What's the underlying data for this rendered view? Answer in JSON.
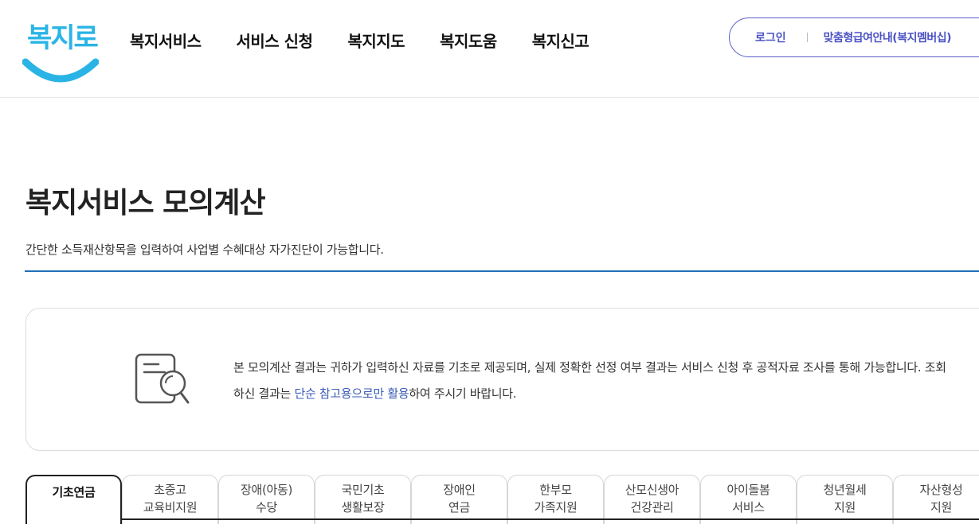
{
  "brand": {
    "logo_text": "복지로",
    "color": "#2ab4e6"
  },
  "nav": {
    "items": [
      {
        "label": "복지서비스"
      },
      {
        "label": "서비스 신청"
      },
      {
        "label": "복지지도"
      },
      {
        "label": "복지도움"
      },
      {
        "label": "복지신고"
      }
    ]
  },
  "util": {
    "login": "로그인",
    "member": "맞춤형급여안내(복지멤버십)"
  },
  "page": {
    "title": "복지서비스 모의계산",
    "description": "간단한 소득재산항목을 입력하여 사업별 수혜대상 자가진단이 가능합니다."
  },
  "notice": {
    "icon": "document-search-icon",
    "text_before": "본 모의계산 결과는 귀하가 입력하신 자료를 기초로 제공되며, 실제 정확한 선정 여부 결과는 서비스 신청 후 공적자료 조사를 통해 가능합니다. 조회하신 결과는 ",
    "highlight": "단순 참고용으로만 활용",
    "text_after": "하여 주시기 바랍니다."
  },
  "tabs": [
    {
      "label": "기초연금",
      "active": true
    },
    {
      "label": "초중고\n교육비지원",
      "active": false
    },
    {
      "label": "장애(아동)\n수당",
      "active": false
    },
    {
      "label": "국민기초\n생활보장",
      "active": false
    },
    {
      "label": "장애인\n연금",
      "active": false
    },
    {
      "label": "한부모\n가족지원",
      "active": false
    },
    {
      "label": "산모신생아\n건강관리",
      "active": false
    },
    {
      "label": "아이돌봄\n서비스",
      "active": false
    },
    {
      "label": "청년월세\n지원",
      "active": false
    },
    {
      "label": "자산형성\n지원",
      "active": false
    }
  ],
  "colors": {
    "accent": "#4c53c4",
    "rule": "#1f6fb5",
    "link": "#3b5bb7"
  }
}
